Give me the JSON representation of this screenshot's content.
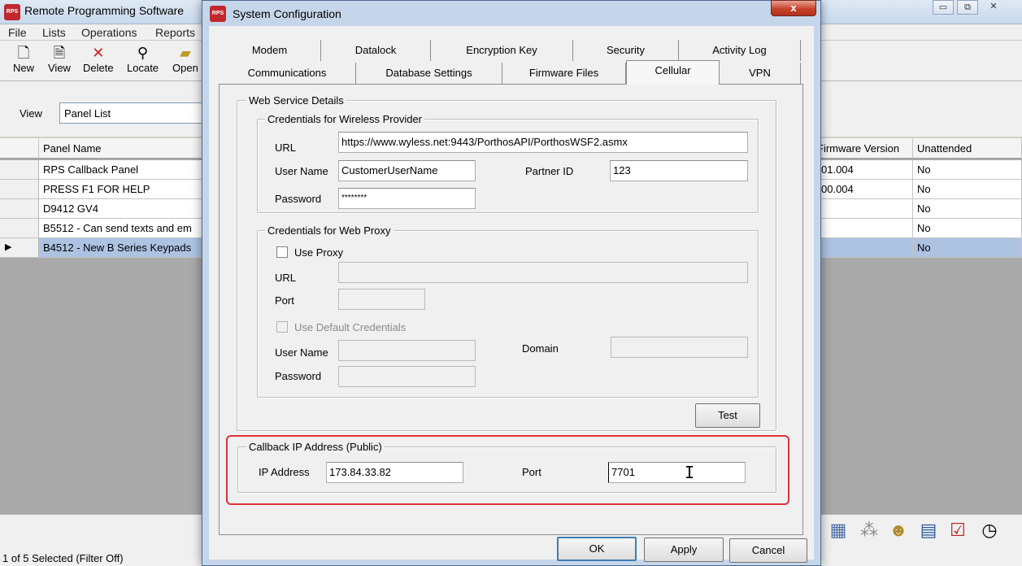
{
  "main": {
    "title": "Remote Programming Software",
    "app_icon": "RPS",
    "window_controls": [
      "▭",
      "⧉",
      "✕"
    ],
    "menu": [
      "File",
      "Lists",
      "Operations",
      "Reports"
    ],
    "toolbar": [
      {
        "label": "New",
        "icon": "new-document-icon"
      },
      {
        "label": "View",
        "icon": "view-icon"
      },
      {
        "label": "Delete",
        "icon": "delete-icon"
      },
      {
        "label": "Locate",
        "icon": "binoculars-icon"
      },
      {
        "label": "Open",
        "icon": "open-folder-icon"
      }
    ],
    "view_label": "View",
    "view_value": "Panel List",
    "columns": [
      "Panel Name",
      "Firmware Version",
      "Unattended"
    ],
    "rows": [
      {
        "name": "RPS Callback Panel",
        "firmware": "01.004",
        "unattended": "No"
      },
      {
        "name": "PRESS F1 FOR HELP",
        "firmware": "00.004",
        "unattended": "No"
      },
      {
        "name": "D9412 GV4",
        "firmware": "",
        "unattended": "No"
      },
      {
        "name": "B5512 - Can send texts and em",
        "firmware": "",
        "unattended": "No"
      },
      {
        "name": "B4512 - New B Series Keypads",
        "firmware": "",
        "unattended": "No"
      }
    ],
    "selected_row_marker": "▶",
    "status": "1 of 5 Selected (Filter Off)"
  },
  "dialog": {
    "title": "System Configuration",
    "close": "x",
    "tabs_row1": [
      "Modem",
      "Datalock",
      "Encryption Key",
      "Security",
      "Activity Log"
    ],
    "tabs_row2": [
      "Communications",
      "Database Settings",
      "Firmware Files",
      "Cellular",
      "VPN"
    ],
    "active_tab": "Cellular",
    "web_service": {
      "legend": "Web Service Details",
      "wireless": {
        "legend": "Credentials for Wireless Provider",
        "url_label": "URL",
        "url": "https://www.wyless.net:9443/PorthosAPI/PorthosWSF2.asmx",
        "user_label": "User Name",
        "user": "CustomerUserName",
        "partner_label": "Partner ID",
        "partner": "123",
        "password_label": "Password",
        "password": "********"
      },
      "proxy": {
        "legend": "Credentials for Web Proxy",
        "use_proxy": "Use Proxy",
        "url_label": "URL",
        "url": "",
        "port_label": "Port",
        "port": "",
        "use_default": "Use Default Credentials",
        "user_label": "User Name",
        "user": "",
        "domain_label": "Domain",
        "domain": "",
        "password_label": "Password",
        "password": ""
      },
      "test_button": "Test"
    },
    "callback": {
      "legend": "Callback IP Address (Public)",
      "ip_label": "IP Address",
      "ip": "173.84.33.82",
      "port_label": "Port",
      "port": "7701"
    },
    "buttons": {
      "ok": "OK",
      "apply": "Apply",
      "cancel": "Cancel"
    }
  }
}
